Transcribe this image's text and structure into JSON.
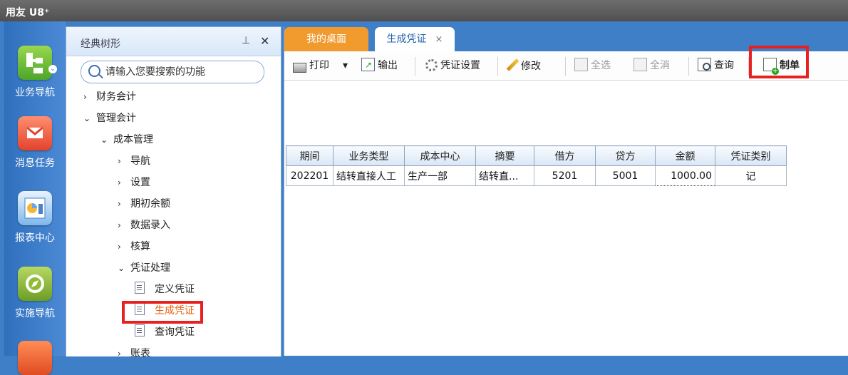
{
  "app": {
    "title": "用友 U8⁺"
  },
  "left_nav": [
    {
      "label": "业务导航",
      "icon": "business-navigation-icon"
    },
    {
      "label": "消息任务",
      "icon": "message-task-icon"
    },
    {
      "label": "报表中心",
      "icon": "report-center-icon"
    },
    {
      "label": "实施导航",
      "icon": "implementation-navigation-icon"
    }
  ],
  "tree_panel": {
    "title": "经典树形",
    "search_placeholder": "请输入您要搜索的功能",
    "items": [
      {
        "label": "财务会计",
        "arrow": "›"
      },
      {
        "label": "管理会计",
        "arrow": "⌄"
      },
      {
        "label": "成本管理",
        "arrow": "⌄"
      },
      {
        "label": "导航",
        "arrow": "›"
      },
      {
        "label": "设置",
        "arrow": "›"
      },
      {
        "label": "期初余额",
        "arrow": "›"
      },
      {
        "label": "数据录入",
        "arrow": "›"
      },
      {
        "label": "核算",
        "arrow": "›"
      },
      {
        "label": "凭证处理",
        "arrow": "⌄"
      },
      {
        "label": "定义凭证",
        "arrow": ""
      },
      {
        "label": "生成凭证",
        "arrow": ""
      },
      {
        "label": "查询凭证",
        "arrow": ""
      },
      {
        "label": "账表",
        "arrow": "›"
      }
    ]
  },
  "tabs": {
    "desktop": "我的桌面",
    "voucher": "生成凭证",
    "close": "×"
  },
  "toolbar": {
    "print": "打印",
    "print_dropdown": "▾",
    "export": "输出",
    "voucher_settings": "凭证设置",
    "modify": "修改",
    "select_all": "全选",
    "clear_all": "全消",
    "query": "查询",
    "make_voucher": "制单"
  },
  "table": {
    "headers": [
      "期间",
      "业务类型",
      "成本中心",
      "摘要",
      "借方",
      "贷方",
      "金额",
      "凭证类别"
    ],
    "rows": [
      [
        "202201",
        "结转直接人工",
        "生产一部",
        "结转直...",
        "5201",
        "5001",
        "1000.00",
        "记"
      ]
    ]
  },
  "colors": {
    "accent_blue": "#3f7fc7",
    "tab_orange": "#f19a2e",
    "highlight_red": "#e82020"
  }
}
